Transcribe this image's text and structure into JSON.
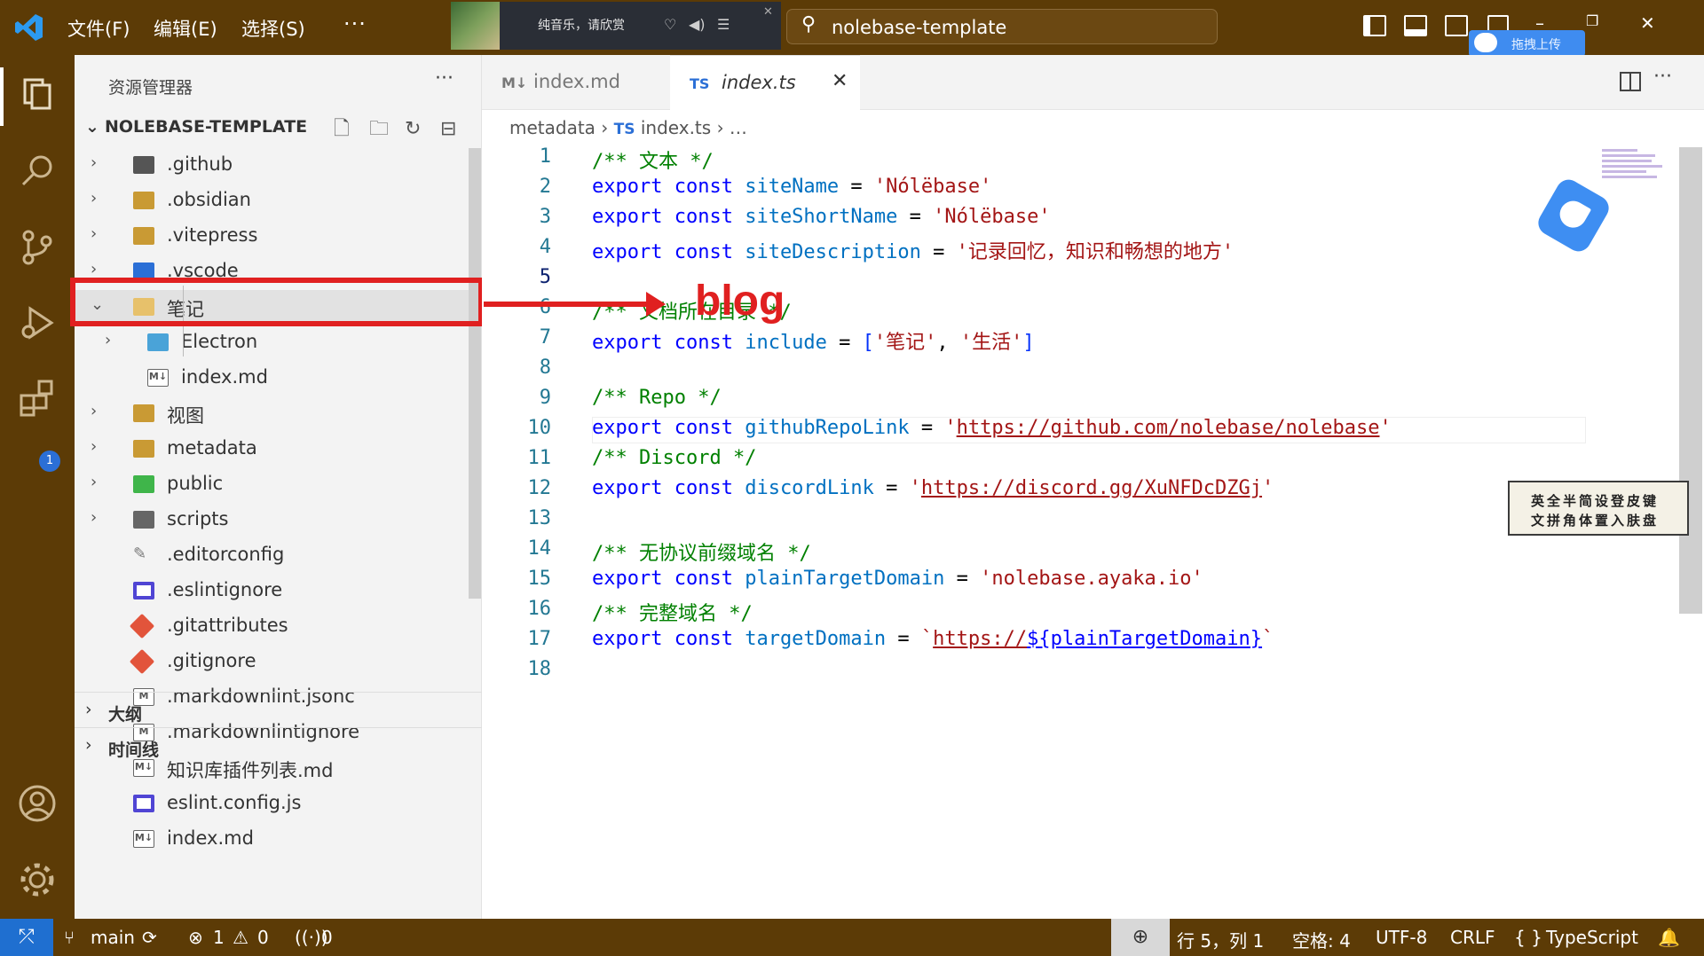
{
  "titlebar": {
    "menu": [
      "文件(F)",
      "编辑(E)",
      "选择(S)"
    ],
    "more": "···",
    "music": {
      "text": "纯音乐，请欣赏"
    },
    "command_center": "nolebase-template",
    "upload_badge": "拖拽上传",
    "window_controls": {
      "minimize": "–",
      "restore": "❐",
      "close": "✕"
    }
  },
  "activity": {
    "extensions_badge": "1"
  },
  "sidebar": {
    "title": "资源管理器",
    "more": "···",
    "project": "NOLEBASE-TEMPLATE",
    "tree": [
      {
        "name": ".github",
        "icon": "github-folder-icon",
        "chevron": "›"
      },
      {
        "name": ".obsidian",
        "icon": "folder-icon",
        "chevron": "›"
      },
      {
        "name": ".vitepress",
        "icon": "folder-icon",
        "chevron": "›"
      },
      {
        "name": ".vscode",
        "icon": "vscode-folder-icon",
        "chevron": "›"
      },
      {
        "name": "笔记",
        "icon": "folder-open-icon",
        "chevron": "⌄"
      },
      {
        "name": "Electron",
        "icon": "electron-folder-icon",
        "chevron": "›"
      },
      {
        "name": "index.md",
        "icon": "markdown-icon",
        "chevron": ""
      },
      {
        "name": "视图",
        "icon": "folder-icon",
        "chevron": "›"
      },
      {
        "name": "metadata",
        "icon": "folder-icon",
        "chevron": "›"
      },
      {
        "name": "public",
        "icon": "public-folder-icon",
        "chevron": "›"
      },
      {
        "name": "scripts",
        "icon": "scripts-folder-icon",
        "chevron": "›"
      },
      {
        "name": ".editorconfig",
        "icon": "editorconfig-icon",
        "chevron": ""
      },
      {
        "name": ".eslintignore",
        "icon": "eslint-icon",
        "chevron": ""
      },
      {
        "name": ".gitattributes",
        "icon": "git-icon",
        "chevron": ""
      },
      {
        "name": ".gitignore",
        "icon": "git-icon",
        "chevron": ""
      },
      {
        "name": ".markdownlint.jsonc",
        "icon": "markdownlint-icon",
        "chevron": ""
      },
      {
        "name": ".markdownlintignore",
        "icon": "markdownlint-icon",
        "chevron": ""
      },
      {
        "name": "知识库插件列表.md",
        "icon": "markdown-icon",
        "chevron": ""
      },
      {
        "name": "eslint.config.js",
        "icon": "eslint-icon",
        "chevron": ""
      },
      {
        "name": "index.md",
        "icon": "markdown-icon",
        "chevron": ""
      }
    ],
    "outline": "大纲",
    "timeline": "时间线"
  },
  "tabs": [
    {
      "label": "index.md",
      "icon": "M↓",
      "active": false
    },
    {
      "label": "index.ts",
      "icon": "TS",
      "active": true,
      "close": "✕"
    }
  ],
  "breadcrumb": {
    "folder": "metadata",
    "ts": "TS",
    "file": "index.ts",
    "more": "…"
  },
  "code": {
    "current_line": 5,
    "lines": [
      "/** 文本 */",
      "export const siteName = 'Nólëbase'",
      "export const siteShortName = 'Nólëbase'",
      "export const siteDescription = '记录回忆，知识和畅想的地方'",
      "",
      "/** 文档所在目录 */",
      "export const include = ['笔记', '生活']",
      "",
      "/** Repo */",
      "export const githubRepoLink = 'https://github.com/nolebase/nolebase'",
      "/** Discord */",
      "export const discordLink = 'https://discord.gg/XuNFDcDZGj'",
      "",
      "/** 无协议前缀域名 */",
      "export const plainTargetDomain = 'nolebase.ayaka.io'",
      "/** 完整域名 */",
      "export const targetDomain = `https://${plainTargetDomain}`",
      ""
    ]
  },
  "annotation": {
    "label": "blog"
  },
  "ime": {
    "row1": "英全半简设登皮键",
    "row2": "文拼角体置入肤盘"
  },
  "statusbar": {
    "branch": "main",
    "errors": "1",
    "warnings": "0",
    "ports": "0",
    "position": "行 5，列 1",
    "spaces": "空格: 4",
    "encoding": "UTF-8",
    "eol": "CRLF",
    "language": "TypeScript"
  },
  "colors": {
    "chrome": "#5c3b06",
    "accent_blue": "#1f6fd0",
    "annotation_red": "#e02020"
  }
}
